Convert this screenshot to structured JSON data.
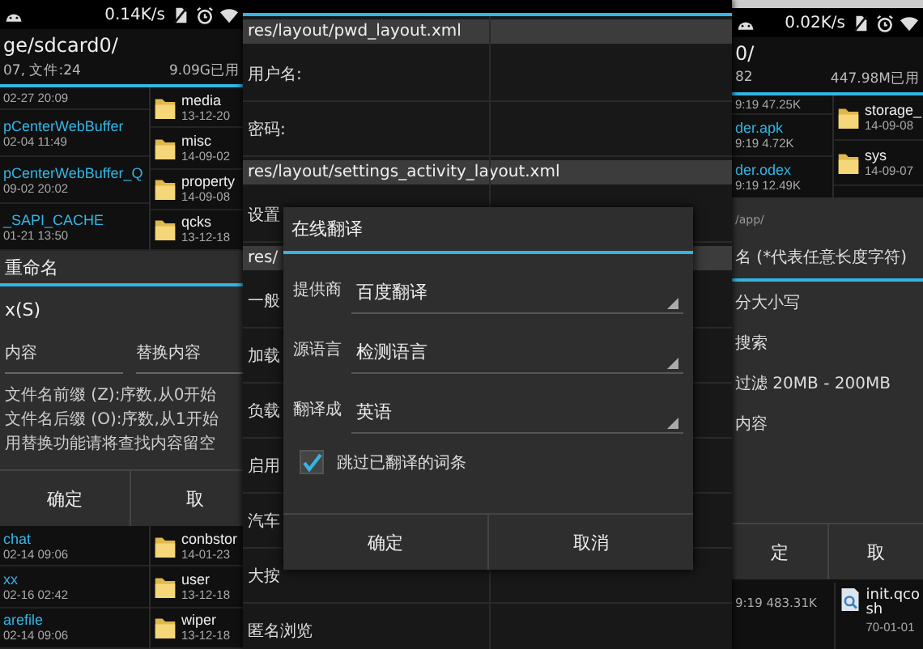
{
  "left_screen": {
    "status_bar": {
      "speed": "0.14K/s"
    },
    "path": "ge/sdcard0/",
    "summary": "07, 文件:24",
    "storage": "9.09G已用",
    "files": [
      {
        "date": "02-27 20:09"
      },
      {
        "name": "pCenterWebBuffer",
        "date": "02-04 11:49"
      },
      {
        "name": "pCenterWebBuffer_Q",
        "date": "09-02 20:02"
      },
      {
        "name": "_SAPI_CACHE",
        "date": "01-21 13:50"
      }
    ],
    "folders": [
      {
        "name": "media",
        "date": "13-12-20"
      },
      {
        "name": "misc",
        "date": "14-09-02"
      },
      {
        "name": "property",
        "date": "14-09-08"
      },
      {
        "name": "qcks",
        "date": "13-12-18"
      }
    ],
    "dialog": {
      "title": "重命名",
      "value": "x(S)",
      "find_label": "内容",
      "replace_label": "替换内容",
      "notes": [
        "文件名前缀 (Z):序数,从0开始",
        "文件名后缀 (O):序数,从1开始",
        "用替换功能请将查找内容留空"
      ],
      "buttons": [
        "确定",
        "取"
      ]
    },
    "files_below": [
      {
        "name": "chat",
        "date": "02-14 09:06"
      },
      {
        "name": "xx",
        "date": "02-16 02:42"
      },
      {
        "name": "arefile",
        "date": "02-14 09:06"
      }
    ],
    "folders_below": [
      {
        "name": "conbstor",
        "date": "14-01-23"
      },
      {
        "name": "user",
        "date": "13-12-18"
      },
      {
        "name": "wiper",
        "date": "13-12-18"
      }
    ]
  },
  "middle_screen": {
    "rows": [
      {
        "kind": "header",
        "text": "res/layout/pwd_layout.xml"
      },
      {
        "kind": "field",
        "text": "用户名:"
      },
      {
        "kind": "field",
        "text": "密码:"
      },
      {
        "kind": "header",
        "text": "res/layout/settings_activity_layout.xml"
      },
      {
        "kind": "field",
        "text": "设置"
      },
      {
        "kind": "header",
        "text": "res/"
      },
      {
        "kind": "field",
        "text": "一般"
      },
      {
        "kind": "field",
        "text": "加载"
      },
      {
        "kind": "field",
        "text": "负载"
      },
      {
        "kind": "field",
        "text": "启用"
      },
      {
        "kind": "field",
        "text": "汽车"
      },
      {
        "kind": "field",
        "text": "大按"
      },
      {
        "kind": "field",
        "text": "匿名浏览"
      }
    ],
    "dialog": {
      "title": "在线翻译",
      "options": [
        {
          "label": "提供商",
          "value": "百度翻译"
        },
        {
          "label": "源语言",
          "value": "检测语言"
        },
        {
          "label": "翻译成",
          "value": "英语"
        }
      ],
      "checkbox": {
        "label": "跳过已翻译的词条",
        "checked": true
      },
      "buttons": [
        "确定",
        "取消"
      ]
    }
  },
  "right_screen": {
    "status_bar": {
      "speed": "0.02K/s"
    },
    "path": "0/",
    "summary": "82",
    "storage": "447.98M已用",
    "files": [
      {
        "info": "9:19 47.25K"
      },
      {
        "name": "der.apk",
        "info": "9:19 4.72K"
      },
      {
        "name": "der.odex",
        "info": "9:19 12.49K"
      }
    ],
    "folders": [
      {
        "name": "storage_",
        "date": "14-09-08"
      },
      {
        "name": "sys",
        "date": "14-09-07"
      }
    ],
    "dialog": {
      "path": "/app/",
      "pattern": "名 (*代表任意长度字符)",
      "options": [
        "分大小写",
        "搜索",
        "过滤 20MB - 200MB",
        "内容"
      ],
      "buttons": [
        "定",
        "取"
      ]
    },
    "file_below": {
      "info": "9:19 483.31K",
      "name_lines": [
        "init.qco",
        "sh"
      ],
      "date": "70-01-01"
    }
  }
}
